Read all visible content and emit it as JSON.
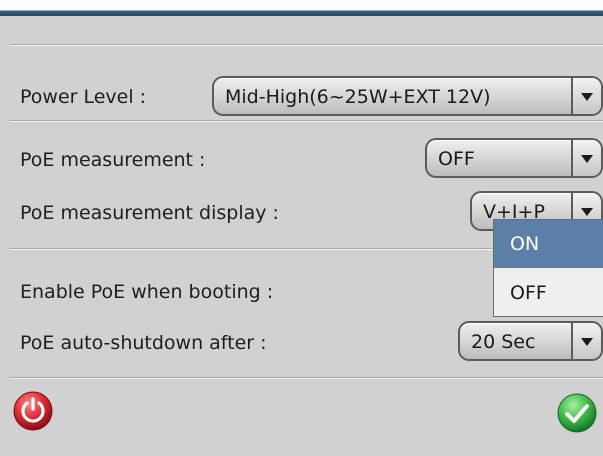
{
  "power_level": {
    "label": "Power Level :",
    "value": "Mid-High(6~25W+EXT 12V)"
  },
  "poe_measurement": {
    "label": "PoE measurement :",
    "value": "OFF"
  },
  "poe_measurement_display": {
    "label": "PoE measurement display :",
    "value": "V+I+P",
    "dropdown_open": true,
    "options": [
      "ON",
      "OFF"
    ],
    "highlighted": "ON"
  },
  "enable_poe_booting": {
    "label": "Enable PoE when booting :"
  },
  "poe_auto_shutdown": {
    "label": "PoE auto-shutdown after :",
    "value": "20 Sec"
  },
  "footer": {
    "reset_icon": "power-reset-icon",
    "confirm_icon": "checkmark-icon"
  },
  "colors": {
    "highlight": "#5b7fa6",
    "reset_red": "#d4202a",
    "confirm_green": "#39b54a",
    "title_bar": "#2b4a72"
  }
}
